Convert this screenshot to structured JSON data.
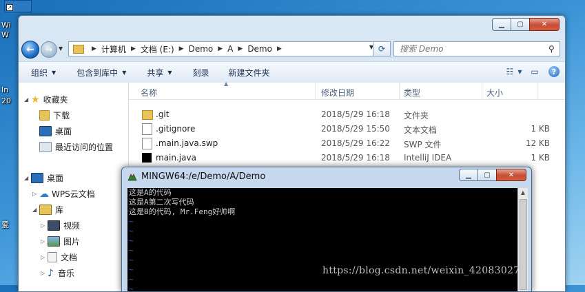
{
  "desktop": {
    "labels": [
      "Wi",
      "W",
      "In",
      "20",
      "爱"
    ]
  },
  "explorer": {
    "address": {
      "crumbs": [
        "计算机",
        "文档 (E:)",
        "Demo",
        "A",
        "Demo"
      ]
    },
    "search": {
      "placeholder": "搜索 Demo"
    },
    "toolbar": {
      "organize": "组织",
      "include_library": "包含到库中",
      "share": "共享",
      "burn": "刻录",
      "new_folder": "新建文件夹"
    },
    "nav": {
      "favorites": "收藏夹",
      "downloads": "下载",
      "desktop": "桌面",
      "recent": "最近访问的位置",
      "desktop_root": "桌面",
      "wps": "WPS云文档",
      "library": "库",
      "videos": "视频",
      "pictures": "图片",
      "documents": "文档",
      "music": "音乐"
    },
    "columns": {
      "name": "名称",
      "modified": "修改日期",
      "type": "类型",
      "size": "大小"
    },
    "files": [
      {
        "name": ".git",
        "modified": "2018/5/29 16:18",
        "type": "文件夹",
        "size": "",
        "icon": "folder-icon"
      },
      {
        "name": ".gitignore",
        "modified": "2018/5/29 15:50",
        "type": "文本文档",
        "size": "1 KB",
        "icon": "text-file-icon"
      },
      {
        "name": ".main.java.swp",
        "modified": "2018/5/29 16:22",
        "type": "SWP 文件",
        "size": "12 KB",
        "icon": "blank-file-icon"
      },
      {
        "name": "main.java",
        "modified": "2018/5/29 16:18",
        "type": "IntelliJ IDEA",
        "size": "1 KB",
        "icon": "intellij-file-icon"
      }
    ]
  },
  "terminal": {
    "title": "MINGW64:/e/Demo/A/Demo",
    "lines": [
      "这是A的代码",
      "这是A第二次写代码",
      "这是B的代码, Mr.Feng好帅啊"
    ],
    "tildes": [
      "~",
      "~",
      "~",
      "~",
      "~",
      "~",
      "~",
      "~"
    ]
  },
  "watermark": "https://blog.csdn.net/weixin_42083027"
}
